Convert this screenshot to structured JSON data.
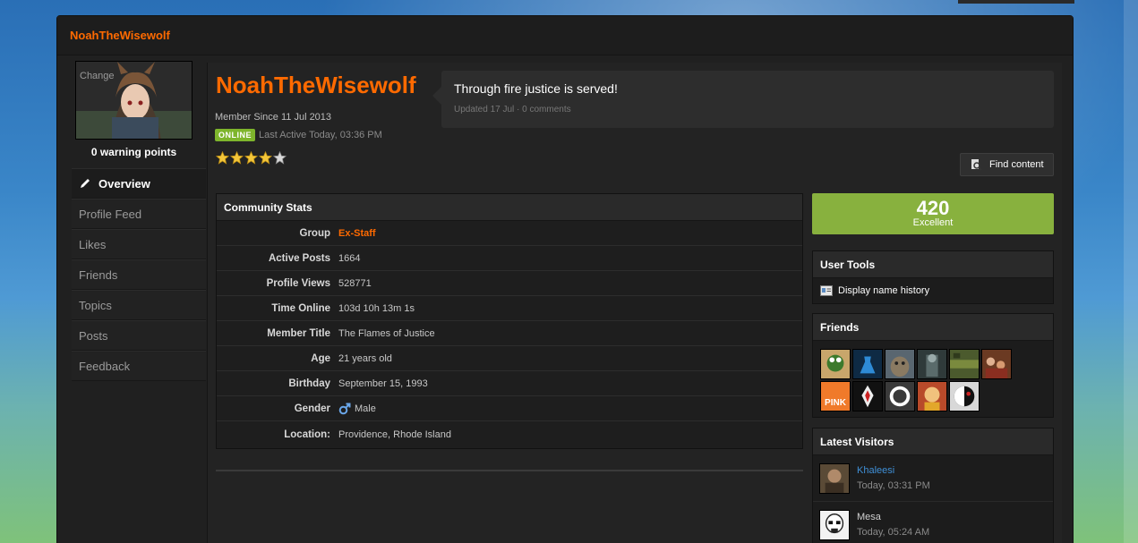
{
  "panel": {
    "title": "NoahTheWisewolf"
  },
  "avatar": {
    "change_label": "Change"
  },
  "warning_points": "0 warning points",
  "side_nav": [
    {
      "label": "Overview",
      "active": true
    },
    {
      "label": "Profile Feed"
    },
    {
      "label": "Likes"
    },
    {
      "label": "Friends"
    },
    {
      "label": "Topics"
    },
    {
      "label": "Posts"
    },
    {
      "label": "Feedback"
    }
  ],
  "profile": {
    "username": "NoahTheWisewolf",
    "member_since": "Member Since 11 Jul 2013",
    "online_badge": "ONLINE",
    "last_active": "Last Active Today, 03:36 PM",
    "rating": {
      "value": 4,
      "max": 5
    }
  },
  "status": {
    "text": "Through fire justice is served!",
    "meta": "Updated 17 Jul · 0 comments"
  },
  "find_content": {
    "label": "Find content"
  },
  "community_stats": {
    "title": "Community Stats",
    "rows": [
      {
        "label": "Group",
        "value": "Ex-Staff",
        "highlight": true
      },
      {
        "label": "Active Posts",
        "value": "1664"
      },
      {
        "label": "Profile Views",
        "value": "528771"
      },
      {
        "label": "Time Online",
        "value": "103d 10h 13m 1s"
      },
      {
        "label": "Member Title",
        "value": "The Flames of Justice"
      },
      {
        "label": "Age",
        "value": "21 years old"
      },
      {
        "label": "Birthday",
        "value": "September 15, 1993"
      },
      {
        "label": "Gender",
        "value": "Male",
        "icon": "male-icon"
      },
      {
        "label": "Location:",
        "value": "Providence, Rhode Island"
      }
    ]
  },
  "reputation": {
    "value": "420",
    "label": "Excellent",
    "color": "#88b13e"
  },
  "user_tools": {
    "title": "User Tools",
    "items": [
      {
        "label": "Display name history",
        "icon": "id-card-icon"
      }
    ]
  },
  "friends": {
    "title": "Friends",
    "count": 12,
    "tile_labels": [
      "PINK"
    ]
  },
  "latest_visitors": {
    "title": "Latest Visitors",
    "items": [
      {
        "name": "Khaleesi",
        "time": "Today, 03:31 PM",
        "name_color": "#3f8fd6"
      },
      {
        "name": "Mesa",
        "time": "Today, 05:24 AM",
        "name_color": "#cfcfcf"
      }
    ]
  },
  "colors": {
    "accent": "#ff6a00",
    "online": "#7eb52c",
    "panel_bg": "#202020"
  }
}
